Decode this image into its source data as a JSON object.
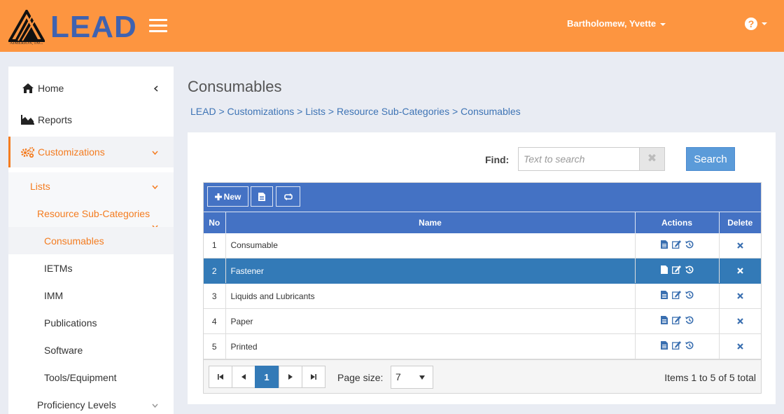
{
  "header": {
    "logo_word": "LEAD",
    "company": "AIMERION, INC.",
    "user_name": "Bartholomew, Yvette",
    "help_glyph": "?",
    "bg_color": "#fd9540"
  },
  "sidebar": {
    "items": [
      {
        "label": "Home",
        "icon": "home-icon"
      },
      {
        "label": "Reports",
        "icon": "area-chart-icon"
      },
      {
        "label": "Customizations",
        "icon": "gears-icon"
      }
    ],
    "sub": {
      "lists": "Lists",
      "resource_sub_categories": "Resource Sub-Categories",
      "children": [
        "Consumables",
        "IETMs",
        "IMM",
        "Publications",
        "Software",
        "Tools/Equipment"
      ],
      "proficiency_levels": "Proficiency Levels"
    }
  },
  "page": {
    "title": "Consumables",
    "breadcrumb": [
      "LEAD",
      "Customizations",
      "Lists",
      "Resource Sub-Categories",
      "Consumables"
    ],
    "breadcrumb_sep": " > "
  },
  "search": {
    "label": "Find:",
    "placeholder": "Text to search",
    "value": "",
    "clear_glyph": "✖",
    "button": "Search"
  },
  "grid": {
    "toolbar": {
      "new_label": "New"
    },
    "columns": [
      "No",
      "Name",
      "Actions",
      "Delete"
    ],
    "rows": [
      {
        "no": "1",
        "name": "Consumable",
        "selected": false
      },
      {
        "no": "2",
        "name": "Fastener",
        "selected": true
      },
      {
        "no": "3",
        "name": "Liquids and Lubricants",
        "selected": false
      },
      {
        "no": "4",
        "name": "Paper",
        "selected": false
      },
      {
        "no": "5",
        "name": "Printed",
        "selected": false
      }
    ],
    "pager": {
      "current_page": "1",
      "page_size_label": "Page size:",
      "page_size": "7",
      "info": "Items 1 to 5 of 5 total"
    },
    "accent": "#4472c4",
    "selected_color": "#337ab7"
  }
}
